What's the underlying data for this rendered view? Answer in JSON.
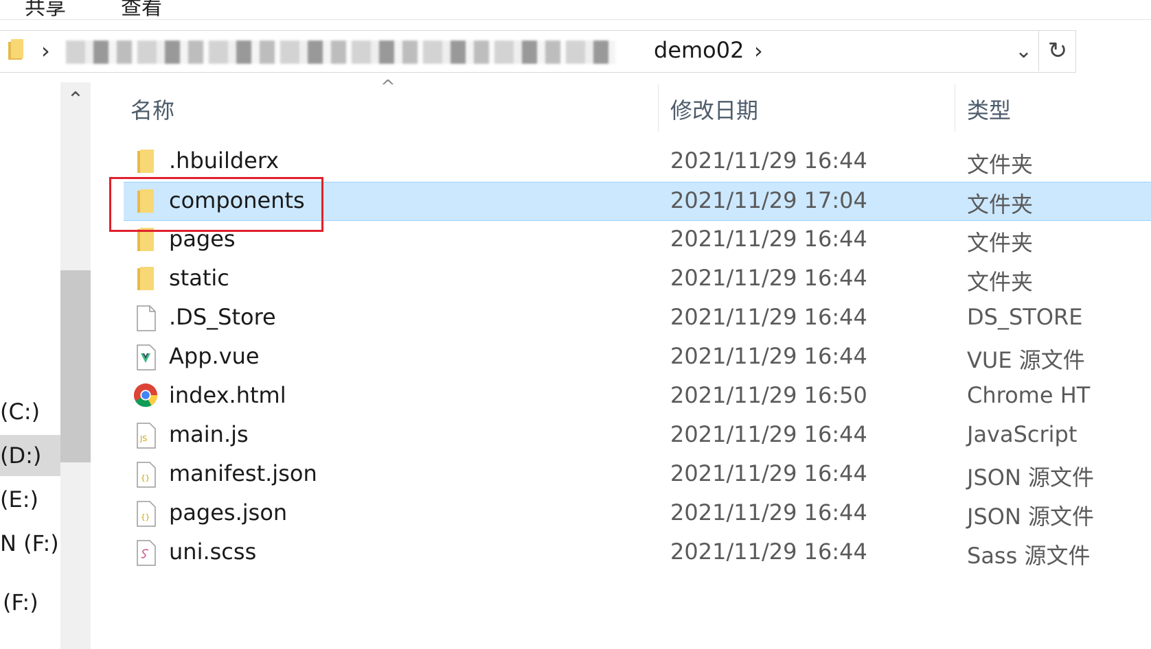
{
  "ribbon": {
    "tabs": [
      "共享",
      "查看"
    ]
  },
  "address_bar": {
    "separator": "›",
    "current_folder": "demo02",
    "dropdown_glyph": "⌄",
    "refresh_glyph": "↻"
  },
  "nav_pane": {
    "items": [
      {
        "label": "(C:)"
      },
      {
        "label": "(D:)"
      },
      {
        "label": "(E:)"
      },
      {
        "label": "N (F:)"
      },
      {
        "label": "(F:)"
      }
    ],
    "scroll_up_glyph": "⌃"
  },
  "columns": {
    "name": "名称",
    "modified": "修改日期",
    "type": "类型",
    "sort_glyph": "^"
  },
  "files": [
    {
      "name": ".hbuilderx",
      "modified": "2021/11/29 16:44",
      "type": "文件夹",
      "icon": "folder-icon"
    },
    {
      "name": "components",
      "modified": "2021/11/29 17:04",
      "type": "文件夹",
      "icon": "folder-icon"
    },
    {
      "name": "pages",
      "modified": "2021/11/29 16:44",
      "type": "文件夹",
      "icon": "folder-icon"
    },
    {
      "name": "static",
      "modified": "2021/11/29 16:44",
      "type": "文件夹",
      "icon": "folder-icon"
    },
    {
      "name": ".DS_Store",
      "modified": "2021/11/29 16:44",
      "type": "DS_STORE",
      "icon": "blank-file-icon"
    },
    {
      "name": "App.vue",
      "modified": "2021/11/29 16:44",
      "type": "VUE 源文件",
      "icon": "vue-file-icon"
    },
    {
      "name": "index.html",
      "modified": "2021/11/29 16:50",
      "type": "Chrome HT",
      "icon": "chrome-icon"
    },
    {
      "name": "main.js",
      "modified": "2021/11/29 16:44",
      "type": "JavaScript",
      "icon": "js-file-icon"
    },
    {
      "name": "manifest.json",
      "modified": "2021/11/29 16:44",
      "type": "JSON 源文件",
      "icon": "json-file-icon"
    },
    {
      "name": "pages.json",
      "modified": "2021/11/29 16:44",
      "type": "JSON 源文件",
      "icon": "json-file-icon"
    },
    {
      "name": "uni.scss",
      "modified": "2021/11/29 16:44",
      "type": "Sass 源文件",
      "icon": "sass-file-icon"
    }
  ],
  "colors": {
    "selection_bg": "#cce8ff",
    "selection_border": "#99d1ff",
    "annotation_red": "#e0202d",
    "folder_yellow": "#f8d775"
  }
}
